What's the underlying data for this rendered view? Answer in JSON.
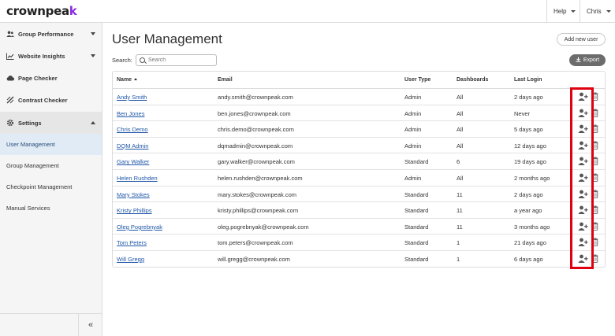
{
  "app": {
    "logo_text": "crownpeak",
    "logo_accent_color": "#8a2be2"
  },
  "topnav": {
    "help_label": "Help",
    "user_label": "Chris"
  },
  "sidebar": {
    "items": [
      {
        "label": "Group Performance",
        "icon": "users-icon"
      },
      {
        "label": "Website Insights",
        "icon": "chart-icon"
      },
      {
        "label": "Page Checker",
        "icon": "cloud-icon"
      },
      {
        "label": "Contrast Checker",
        "icon": "contrast-icon"
      },
      {
        "label": "Settings",
        "icon": "gear-icon"
      }
    ],
    "sub_items": [
      {
        "label": "User Management",
        "active": true
      },
      {
        "label": "Group Management"
      },
      {
        "label": "Checkpoint Management"
      },
      {
        "label": "Manual Services"
      }
    ],
    "collapse_label": "«"
  },
  "main": {
    "title": "User Management",
    "add_button_label": "Add new user",
    "search_label": "Search:",
    "search_placeholder": "Search",
    "export_label": "Export"
  },
  "table": {
    "columns": [
      "Name",
      "Email",
      "User Type",
      "Dashboards",
      "Last Login"
    ],
    "rows": [
      {
        "name": "Andy Smith",
        "email": "andy.smith@crownpeak.com",
        "type": "Admin",
        "dashboards": "All",
        "last_login": "2 days ago"
      },
      {
        "name": "Ben Jones",
        "email": "ben.jones@crownpeak.com",
        "type": "Admin",
        "dashboards": "All",
        "last_login": "Never"
      },
      {
        "name": "Chris Demo",
        "email": "chris.demo@crownpeak.com",
        "type": "Admin",
        "dashboards": "All",
        "last_login": "5 days ago"
      },
      {
        "name": "DQM Admin",
        "email": "dqmadmin@crownpeak.com",
        "type": "Admin",
        "dashboards": "All",
        "last_login": "12 days ago"
      },
      {
        "name": "Gary Walker",
        "email": "gary.walker@crownpeak.com",
        "type": "Standard",
        "dashboards": "6",
        "last_login": "19 days ago"
      },
      {
        "name": "Helen Rushden",
        "email": "helen.rushden@crownpeak.com",
        "type": "Admin",
        "dashboards": "All",
        "last_login": "2 months ago"
      },
      {
        "name": "Mary Stokes",
        "email": "mary.stokes@crownpeak.com",
        "type": "Standard",
        "dashboards": "11",
        "last_login": "2 days ago"
      },
      {
        "name": "Kristy Phillips",
        "email": "kristy.phillips@crownpeak.com",
        "type": "Standard",
        "dashboards": "11",
        "last_login": "a year ago"
      },
      {
        "name": "Oleg Pogrebnyak",
        "email": "oleg.pogrebnyak@crownpeak.com",
        "type": "Standard",
        "dashboards": "11",
        "last_login": "3 months ago"
      },
      {
        "name": "Tom Peters",
        "email": "tom.peters@crownpeak.com",
        "type": "Standard",
        "dashboards": "1",
        "last_login": "21 days ago"
      },
      {
        "name": "Will Gregg",
        "email": "will.gregg@crownpeak.com",
        "type": "Standard",
        "dashboards": "1",
        "last_login": "6 days ago"
      }
    ],
    "row_actions": [
      "user-plus-icon",
      "trash-icon"
    ]
  },
  "colors": {
    "highlight": "#e0000f",
    "link": "#1f57a8",
    "active_nav": "#e1ebf5",
    "export_bg": "#6c6c6c"
  }
}
